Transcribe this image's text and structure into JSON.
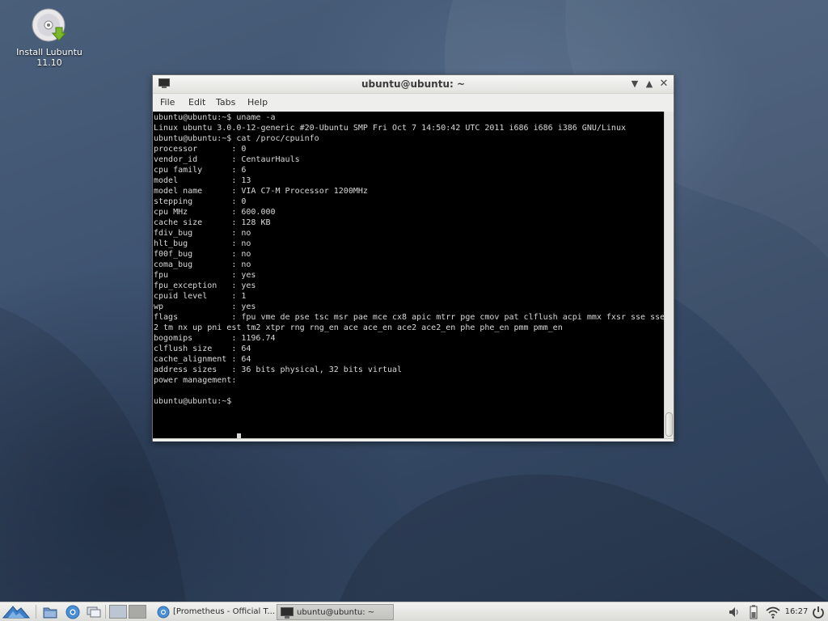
{
  "desktop": {
    "icon_label_line1": "Install Lubuntu",
    "icon_label_line2": "11.10",
    "icon_name": "cd-install-icon"
  },
  "window": {
    "title": "ubuntu@ubuntu: ~",
    "menu": {
      "file": "File",
      "edit": "Edit",
      "tabs": "Tabs",
      "help": "Help"
    },
    "terminal_text": "ubuntu@ubuntu:~$ uname -a\nLinux ubuntu 3.0.0-12-generic #20-Ubuntu SMP Fri Oct 7 14:50:42 UTC 2011 i686 i686 i386 GNU/Linux\nubuntu@ubuntu:~$ cat /proc/cpuinfo\nprocessor\t: 0\nvendor_id\t: CentaurHauls\ncpu family\t: 6\nmodel\t\t: 13\nmodel name\t: VIA C7-M Processor 1200MHz\nstepping\t: 0\ncpu MHz\t\t: 600.000\ncache size\t: 128 KB\nfdiv_bug\t: no\nhlt_bug\t\t: no\nf00f_bug\t: no\ncoma_bug\t: no\nfpu\t\t: yes\nfpu_exception\t: yes\ncpuid level\t: 1\nwp\t\t: yes\nflags\t\t: fpu vme de pse tsc msr pae mce cx8 apic mtrr pge cmov pat clflush acpi mmx fxsr sse sse\n2 tm nx up pni est tm2 xtpr rng rng_en ace ace_en ace2 ace2_en phe phe_en pmm pmm_en\nbogomips\t: 1196.74\nclflush size\t: 64\ncache_alignment\t: 64\naddress sizes\t: 36 bits physical, 32 bits virtual\npower management:\n\nubuntu@ubuntu:~$ "
  },
  "taskbar": {
    "tasks": [
      {
        "label": "[Prometheus - Official T...",
        "icon": "chromium-icon"
      },
      {
        "label": "ubuntu@ubuntu: ~",
        "icon": "terminal-icon"
      }
    ],
    "clock": "16:27"
  },
  "colors": {
    "terminal_bg": "#000000",
    "terminal_fg": "#d9d9d9",
    "desktop_bg": "#3d5270",
    "panel_bg": "#e6e6e2"
  }
}
